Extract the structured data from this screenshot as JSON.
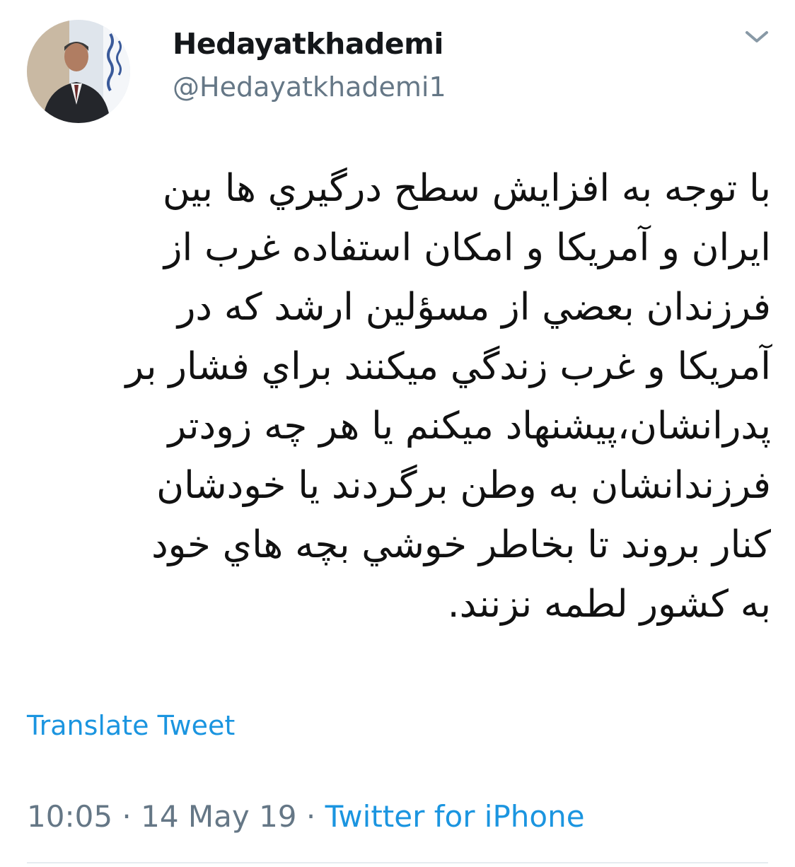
{
  "user": {
    "display_name": "Hedayatkhademi",
    "handle": "@Hedayatkhademi1"
  },
  "tweet": {
    "lines": [
      "با توجه به افزايش سطح درگيري ها بين",
      "ايران و آمريكا و امكان استفاده غرب از",
      "فرزندان بعضي از مسؤلين ارشد كه در",
      "آمريكا و غرب  زندگي ميكنند براي فشار بر",
      "پدرانشان،پيشنهاد ميكنم يا  هر چه زودتر",
      "فرزندانشان به وطن برگردند يا خودشان",
      "كنار بروند تا بخاطر خوشي  بچه هاي خود",
      "به كشور لطمه نزنند."
    ],
    "translate_label": "Translate Tweet"
  },
  "meta": {
    "time": "10:05",
    "sep1": " · ",
    "date": "14 May 19",
    "sep2": " · ",
    "source": "Twitter for iPhone"
  },
  "icons": {
    "avatar": "profile-photo",
    "menu": "chevron-down-icon"
  },
  "colors": {
    "link": "#1b95e0",
    "secondary": "#657786",
    "text": "#14171a"
  }
}
